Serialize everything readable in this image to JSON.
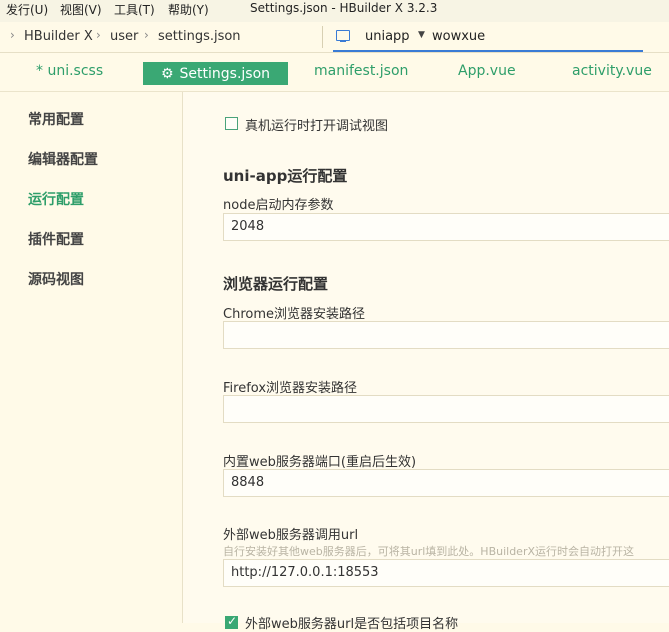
{
  "menubar": {
    "items": [
      "发行(U)",
      "视图(V)",
      "工具(T)",
      "帮助(Y)"
    ],
    "window_title": "Settings.json - HBuilder X 3.2.3"
  },
  "pathbar": {
    "breadcrumb": [
      "HBuilder X",
      "user",
      "settings.json"
    ],
    "run_target": "uniapp",
    "project": "wowxue"
  },
  "tabs": [
    {
      "label": "* uni.scss"
    },
    {
      "label": "Settings.json",
      "active": true
    },
    {
      "label": "manifest.json"
    },
    {
      "label": "App.vue"
    },
    {
      "label": "activity.vue"
    }
  ],
  "sidebar": {
    "items": [
      {
        "label": "常用配置"
      },
      {
        "label": "编辑器配置"
      },
      {
        "label": "运行配置",
        "active": true
      },
      {
        "label": "插件配置"
      },
      {
        "label": "源码视图"
      }
    ]
  },
  "settings": {
    "debug_view_label": "真机运行时打开调试视图",
    "debug_view_checked": false,
    "uniapp_section": "uni-app运行配置",
    "node_memory_label": "node启动内存参数",
    "node_memory_value": "2048",
    "browser_section": "浏览器运行配置",
    "chrome_label": "Chrome浏览器安装路径",
    "chrome_value": "",
    "firefox_label": "Firefox浏览器安装路径",
    "firefox_value": "",
    "webserver_port_label": "内置web服务器端口(重启后生效)",
    "webserver_port_value": "8848",
    "external_url_label": "外部web服务器调用url",
    "external_url_hint": "自行安装好其他web服务器后，可将其url填到此处。HBuilderX运行时会自动打开这",
    "external_url_value": "http://127.0.0.1:18553",
    "include_project_label": "外部web服务器url是否包括项目名称",
    "include_project_checked": true
  },
  "colors": {
    "accent": "#3aa874",
    "background": "#fffae8"
  }
}
